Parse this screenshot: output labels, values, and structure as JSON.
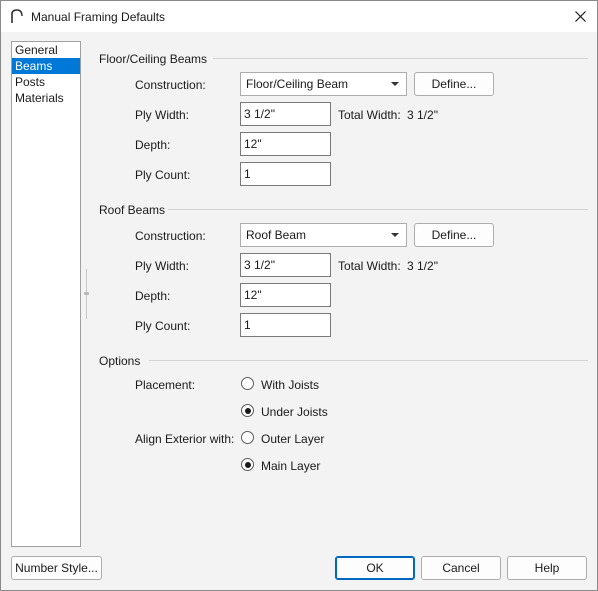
{
  "window": {
    "title": "Manual Framing Defaults",
    "icon": "arch-icon"
  },
  "nav": {
    "items": [
      "General",
      "Beams",
      "Posts",
      "Materials"
    ],
    "selected": "Beams"
  },
  "floor_beams": {
    "title": "Floor/Ceiling Beams",
    "construction_label": "Construction:",
    "construction_value": "Floor/Ceiling Beam",
    "define_label": "Define...",
    "ply_width_label": "Ply Width:",
    "ply_width_value": "3 1/2\"",
    "total_width_label": "Total Width:",
    "total_width_value": "3 1/2\"",
    "depth_label": "Depth:",
    "depth_value": "12\"",
    "ply_count_label": "Ply Count:",
    "ply_count_value": "1"
  },
  "roof_beams": {
    "title": "Roof Beams",
    "construction_label": "Construction:",
    "construction_value": "Roof Beam",
    "define_label": "Define...",
    "ply_width_label": "Ply Width:",
    "ply_width_value": "3 1/2\"",
    "total_width_label": "Total Width:",
    "total_width_value": "3 1/2\"",
    "depth_label": "Depth:",
    "depth_value": "12\"",
    "ply_count_label": "Ply Count:",
    "ply_count_value": "1"
  },
  "options": {
    "title": "Options",
    "placement_label": "Placement:",
    "placement_choices": [
      "With Joists",
      "Under Joists"
    ],
    "placement_selected": "Under Joists",
    "align_label": "Align Exterior with:",
    "align_choices": [
      "Outer Layer",
      "Main Layer"
    ],
    "align_selected": "Main Layer"
  },
  "buttons": {
    "number_style": "Number Style...",
    "ok": "OK",
    "cancel": "Cancel",
    "help": "Help"
  },
  "colors": {
    "selection": "#0078d7",
    "default_button_border": "#0067c0"
  }
}
